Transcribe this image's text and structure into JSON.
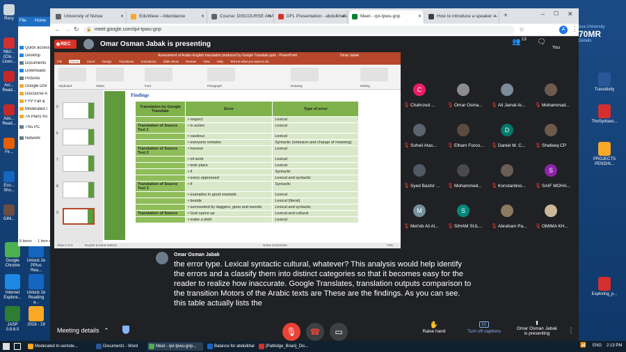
{
  "desktop": {
    "left_icons": [
      {
        "label": "Recy",
        "icon": "recycle-bin-icon",
        "color": "#cfd8dc"
      },
      {
        "label": "Micr... (Cla... Licen...",
        "icon": "app-icon",
        "color": "#d32f2f"
      },
      {
        "label": "Acr... Read...",
        "icon": "acrobat-icon",
        "color": "#c62828"
      },
      {
        "label": "Ado... Read...",
        "icon": "acrobat-icon",
        "color": "#c62828"
      },
      {
        "label": "Fir...",
        "icon": "firefox-icon",
        "color": "#e66000"
      },
      {
        "label": "Eco... Sho...",
        "icon": "app-icon",
        "color": "#1565c0"
      },
      {
        "label": "GIM...",
        "icon": "gimp-icon",
        "color": "#6d4c41"
      }
    ],
    "bottom_icons": [
      {
        "label": "Google Chrome",
        "icon": "chrome-icon",
        "color": "#4caf50"
      },
      {
        "label": "Unlock 2e PPlus Rea...",
        "icon": "book-icon",
        "color": "#1565c0"
      },
      {
        "label": "Internet Explore...",
        "icon": "ie-icon",
        "color": "#1e88e5"
      },
      {
        "label": "Unlock 2e Reading a...",
        "icon": "book-icon",
        "color": "#1565c0"
      },
      {
        "label": "JASP 0.8.6.0",
        "icon": "jasp-icon",
        "color": "#2e7d32"
      },
      {
        "label": "2016 - 19",
        "icon": "folder-icon",
        "color": "#f9a825"
      }
    ],
    "right_icons": [
      {
        "label": "Transitivity",
        "icon": "word-icon",
        "color": "#2b579a"
      },
      {
        "label": "TheSyntaxo...",
        "icon": "pdf-icon",
        "color": "#d32f2f"
      },
      {
        "label": "PROJECTS PENDIN...",
        "icon": "folder-icon",
        "color": "#f9a825"
      },
      {
        "label": "Exploring_p...",
        "icon": "pdf-icon",
        "color": "#d32f2f"
      }
    ],
    "right_badge": {
      "line1": "ova University",
      "line2": "70MR",
      "line3": "Details"
    }
  },
  "explorer": {
    "ribbon_tabs": [
      "File",
      "Home"
    ],
    "items": [
      "Quick access",
      "Desktop",
      "Documents",
      "Downloads",
      "Pictures",
      "Google Driv",
      "Discourse A",
      "FYP Fall &",
      "Moderated I",
      "TA Plans fro",
      "This PC",
      "Network"
    ],
    "status_left": "8 items",
    "status_right": "1 item s"
  },
  "browser": {
    "tabs": [
      {
        "title": "University of Nizwa",
        "color": "#5f6368"
      },
      {
        "title": "EduWave - Attendance",
        "color": "#f9a825"
      },
      {
        "title": "Course: DISCOURSE ANALYSIS",
        "color": "#5f6368"
      },
      {
        "title": "DFL Presentation - abdulkhaliq",
        "color": "#d93025"
      },
      {
        "title": "Meet - qvi-tpwu-gnp",
        "color": "#00832d"
      },
      {
        "title": "How to introduce a speaker —",
        "color": "#3c4043"
      }
    ],
    "url": "meet.google.com/qvi-tpwu-gnp",
    "profile_initial": "A"
  },
  "meet": {
    "rec_label": "REC",
    "presenting_title": "Omar Osman Jabak is presenting",
    "participant_count": "13",
    "you_label": "You",
    "participants": [
      {
        "name": "Chahrzed ...",
        "initial": "C",
        "color": "#e91e63"
      },
      {
        "name": "Omar Osma...",
        "initial": "",
        "color": "#8d8d8d"
      },
      {
        "name": "Ali Jamal Ar...",
        "initial": "",
        "color": "#7b8c9a"
      },
      {
        "name": "Mohammad...",
        "initial": "",
        "color": "#6d5b4f"
      },
      {
        "name": "Soheil Atas...",
        "initial": "",
        "color": "#5a6470"
      },
      {
        "name": "Elham Foroo...",
        "initial": "",
        "color": "#5b4a3f"
      },
      {
        "name": "Daniel M. C...",
        "initial": "D",
        "color": "#00796b"
      },
      {
        "name": "Shafeeq CP",
        "initial": "",
        "color": "#6e5a4a"
      },
      {
        "name": "Syed Bashir ...",
        "initial": "",
        "color": "#4f5a66"
      },
      {
        "name": "Mohammed...",
        "initial": "",
        "color": "#4a4a4a"
      },
      {
        "name": "Konstantino...",
        "initial": "",
        "color": "#6b5e55"
      },
      {
        "name": "SAIF MOHA...",
        "initial": "S",
        "color": "#8e24aa"
      },
      {
        "name": "Met'eb Ali Al...",
        "initial": "M",
        "color": "#78909c"
      },
      {
        "name": "SIHAM SUL...",
        "initial": "S",
        "color": "#00897b"
      },
      {
        "name": "Abraham Pa...",
        "initial": "",
        "color": "#8a7a5e"
      },
      {
        "name": "OMIMA KH...",
        "initial": "",
        "color": "#cbb89a"
      }
    ],
    "caption_speaker": "Omar Osman Jabak",
    "caption_lines": [
      "the error type. Lexical syntactic cultural, whatever? This analysis would help identify",
      "the errors and a classify them into distinct categories so that it becomes easy for the",
      "reader to realize how inaccurate. Google Translates, translation outputs comparison to",
      "the transition Motors of the Arabic texts are These are the findings. As you can see.",
      "this table actually lists the"
    ],
    "meeting_details": "Meeting details",
    "raise_hand": "Raise hand",
    "turn_off_captions": "Turn off captions",
    "presenting_footer_l1": "Omar Osman Jabak",
    "presenting_footer_l2": "is presenting"
  },
  "powerpoint": {
    "title_bar": "Assessment of Arabic-English translation produced by Google Translate.pptx - PowerPoint",
    "user": "Omar Jabak",
    "menu": [
      "File",
      "Home",
      "Insert",
      "Design",
      "Transitions",
      "Animations",
      "Slide Show",
      "Review",
      "View",
      "Help",
      "Tell me what you want to do"
    ],
    "ribbon_groups": [
      "Clipboard",
      "Slides",
      "Font",
      "Paragraph",
      "Drawing",
      "Editing"
    ],
    "thumb_numbers": [
      "5",
      "6",
      "7",
      "8",
      "9"
    ],
    "status": "Slide 9 of 9",
    "status_lang": "English (United States)",
    "status_right": "Notes   Comments",
    "zoom": "73%",
    "findings_heading": "Findings",
    "table_headers": [
      "Translation by Google Translate",
      "Error",
      "Type of error"
    ],
    "rows": [
      {
        "src": "",
        "error": "respect",
        "type": "Lexical"
      },
      {
        "src": "Translation of Source Text 1",
        "error": "in action",
        "type": "Lexical"
      },
      {
        "src": "",
        "error": "cautious",
        "type": "Lexical"
      },
      {
        "src": "",
        "error": "everyone remains",
        "type": "Syntactic (omission and change of meaning)"
      },
      {
        "src": "Translation of Source Text 2",
        "error": "harvest",
        "type": "Lexical"
      },
      {
        "src": "",
        "error": "oil work",
        "type": "Lexical"
      },
      {
        "src": "",
        "error": "took place",
        "type": "Lexical"
      },
      {
        "src": "",
        "error": "if",
        "type": "Syntactic"
      },
      {
        "src": "",
        "error": "every oppressed",
        "type": "Lexical and syntactic"
      },
      {
        "src": "Translation of Source Text 3",
        "error": "if",
        "type": "Syntactic"
      },
      {
        "src": "",
        "error": "examples in good example",
        "type": "Lexical"
      },
      {
        "src": "",
        "error": "beside",
        "type": "Lexical (literal)"
      },
      {
        "src": "",
        "error": "surrounded by daggers, guns and swords",
        "type": "Lexical and syntactic"
      },
      {
        "src": "Translation of Source",
        "error": "God opens up",
        "type": "Lexical and cultural"
      },
      {
        "src": "",
        "error": "make a debt",
        "type": "Lexical"
      }
    ]
  },
  "taskbar": {
    "items": [
      {
        "label": "Moderated In-semste...",
        "color": "#f9a825"
      },
      {
        "label": "Document1 - Word",
        "color": "#2b579a"
      },
      {
        "label": "Meet - qvi-tpwu-gnp...",
        "color": "#4caf50"
      },
      {
        "label": "Balance for abdulkhaliq",
        "color": "#1565c0"
      },
      {
        "label": "[Paltridge_Brian]_Dis...",
        "color": "#d32f2f"
      }
    ],
    "lang": "ENG",
    "time": "2:13 PM"
  }
}
